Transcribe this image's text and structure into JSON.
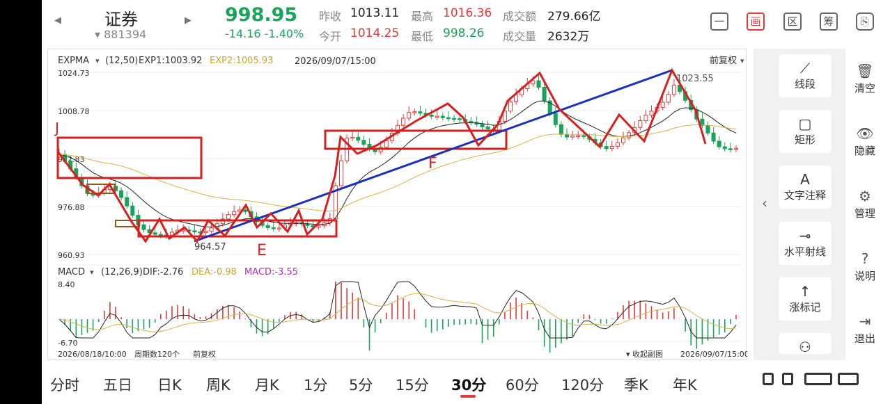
{
  "header": {
    "prev_arrow": "◀",
    "next_arrow": "▶",
    "title": "证券",
    "code": "881394",
    "price": "998.95",
    "change": "-14.16 -1.40%",
    "quotes": [
      {
        "label": "昨收",
        "value": "1013.11"
      },
      {
        "label": "最高",
        "value": "1016.36"
      },
      {
        "label": "成交额",
        "value": "279.66亿"
      },
      {
        "label": "今开",
        "value": "1014.25"
      },
      {
        "label": "最低",
        "value": "998.26"
      },
      {
        "label": "成交量",
        "value": "2632万"
      }
    ],
    "icons": [
      "minus-icon",
      "draw-icon",
      "range-icon",
      "chip-icon",
      "device-switch-icon"
    ],
    "icon_labels": [
      "一",
      "画",
      "区",
      "筹",
      "⎘"
    ]
  },
  "main_chart": {
    "indicator": "EXPMA",
    "params": "(12,50)",
    "exp1": "EXP1:1003.92",
    "exp2": "EXP2:1005.93",
    "datetime": "2026/09/07/15:00",
    "adjust": "前复权",
    "y_labels": [
      "1024.73",
      "1008.78",
      "992.83",
      "976.88",
      "960.93"
    ],
    "high_label": "1023.55",
    "low_label": "964.57",
    "annot_e": "E",
    "annot_f": "F"
  },
  "macd": {
    "indicator": "MACD",
    "params": "(12,26,9)",
    "dif": "DIF:-2.76",
    "dea": "DEA:-0.98",
    "macd": "MACD:-3.55",
    "y_top": "8.40",
    "y_bottom": "-6.70"
  },
  "footer": {
    "start_time": "2026/08/18/10:00",
    "period_count": "周期数120个",
    "adjust": "前复权",
    "collapse": "收起副图",
    "end_time": "2026/09/07/15:00"
  },
  "tools": {
    "items": [
      {
        "icon": "line-segment-icon",
        "glyph": "⟋",
        "label": "线段"
      },
      {
        "icon": "rectangle-icon",
        "glyph": "▢",
        "label": "矩形"
      },
      {
        "icon": "text-icon",
        "glyph": "A",
        "label": "文字注释"
      },
      {
        "icon": "horizontal-ray-icon",
        "glyph": "⊸",
        "label": "水平射线"
      },
      {
        "icon": "rise-mark-icon",
        "glyph": "↑",
        "label": "涨标记"
      },
      {
        "icon": "wave-icon",
        "glyph": "⚇",
        "label": ""
      }
    ],
    "chevron": "‹"
  },
  "side": {
    "items": [
      {
        "icon": "trash-icon",
        "glyph": "🗑",
        "label": "清空"
      },
      {
        "icon": "eye-icon",
        "glyph": "👁",
        "label": "隐藏"
      },
      {
        "icon": "gear-icon",
        "glyph": "⚙",
        "label": "管理"
      },
      {
        "icon": "help-icon",
        "glyph": "?",
        "label": "说明"
      },
      {
        "icon": "exit-icon",
        "glyph": "⇥",
        "label": "退出"
      }
    ]
  },
  "periods": [
    "分时",
    "五日",
    "日K",
    "周K",
    "月K",
    "1分",
    "5分",
    "15分",
    "30分",
    "60分",
    "120分",
    "季K",
    "年K"
  ],
  "active_period": "30分",
  "colors": {
    "up": "#e23b3b",
    "down": "#19a35b",
    "blue_line": "#1c2fb8"
  }
}
